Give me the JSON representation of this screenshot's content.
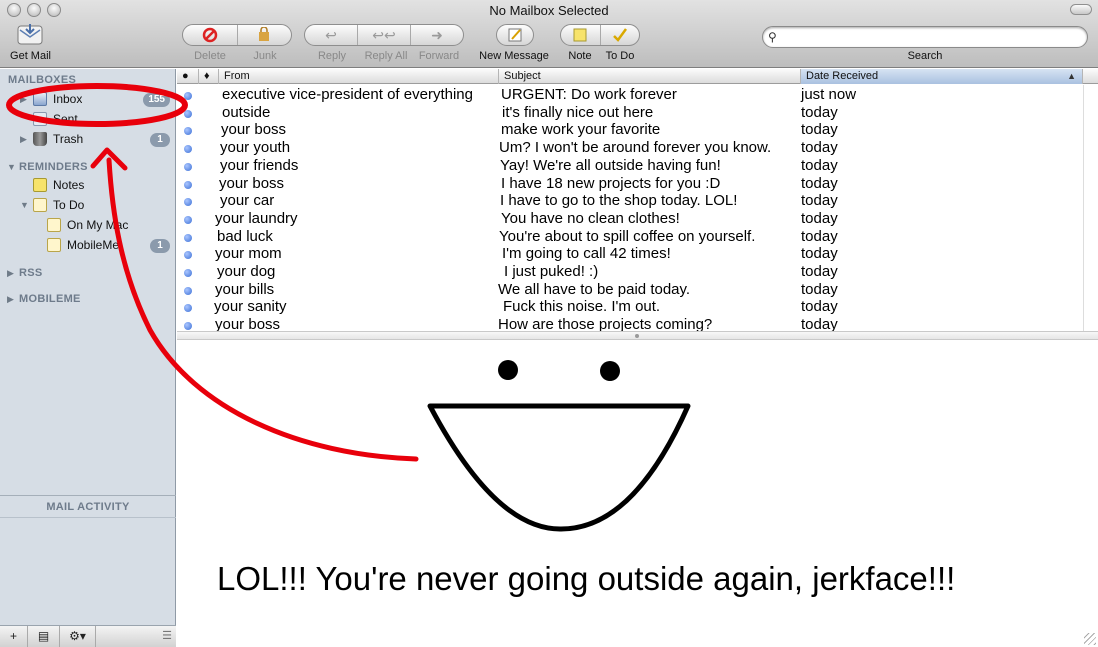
{
  "window": {
    "title": "No Mailbox Selected"
  },
  "toolbar": {
    "get_mail": "Get Mail",
    "delete": "Delete",
    "junk": "Junk",
    "reply": "Reply",
    "reply_all": "Reply All",
    "forward": "Forward",
    "new_message": "New Message",
    "note": "Note",
    "todo": "To Do",
    "search_label": "Search",
    "search_value": ""
  },
  "sidebar": {
    "mailboxes_header": "MAILBOXES",
    "inbox_label": "Inbox",
    "inbox_count": "155",
    "sent_label": "Sent",
    "trash_label": "Trash",
    "trash_count": "1",
    "reminders_header": "REMINDERS",
    "notes_label": "Notes",
    "todo_label": "To Do",
    "on_my_mac_label": "On My Mac",
    "mobileme_item_label": "MobileMe",
    "mobileme_item_count": "1",
    "rss_header": "RSS",
    "mobileme_header": "MOBILEME",
    "activity_title": "MAIL ACTIVITY"
  },
  "list": {
    "columns": {
      "from": "From",
      "subject": "Subject",
      "date": "Date Received"
    },
    "rows": [
      {
        "from": "executive vice-president of everything",
        "subject": "URGENT: Do work forever",
        "date": "just now"
      },
      {
        "from": "outside",
        "subject": "it's finally nice out here",
        "date": "today"
      },
      {
        "from": "your boss",
        "subject": "make work your favorite",
        "date": "today"
      },
      {
        "from": "your youth",
        "subject": "Um? I won't be around forever you know.",
        "date": "today"
      },
      {
        "from": "your friends",
        "subject": "Yay! We're all outside having fun!",
        "date": "today"
      },
      {
        "from": "your boss",
        "subject": "I have 18 new projects for you :D",
        "date": "today"
      },
      {
        "from": "your car",
        "subject": "I have to go to the shop today. LOL!",
        "date": "today"
      },
      {
        "from": "your laundry",
        "subject": "You have no clean clothes!",
        "date": "today"
      },
      {
        "from": "bad luck",
        "subject": "You're about to spill coffee on yourself.",
        "date": "today"
      },
      {
        "from": "your mom",
        "subject": "I'm going to call 42 times!",
        "date": "today"
      },
      {
        "from": "your dog",
        "subject": "I just puked! :)",
        "date": "today"
      },
      {
        "from": "your bills",
        "subject": "We all have to be paid today.",
        "date": "today"
      },
      {
        "from": "your sanity",
        "subject": "Fuck this noise. I'm out.",
        "date": "today"
      },
      {
        "from": "your boss",
        "subject": "How are those projects coming?",
        "date": "today"
      }
    ]
  },
  "preview": {
    "message": "LOL!!! You're never going outside again, jerkface!!!"
  },
  "colors": {
    "annotation_red": "#e8000b",
    "unread_dot": "#3b6fd6",
    "sidebar_bg": "#d6dde5"
  }
}
